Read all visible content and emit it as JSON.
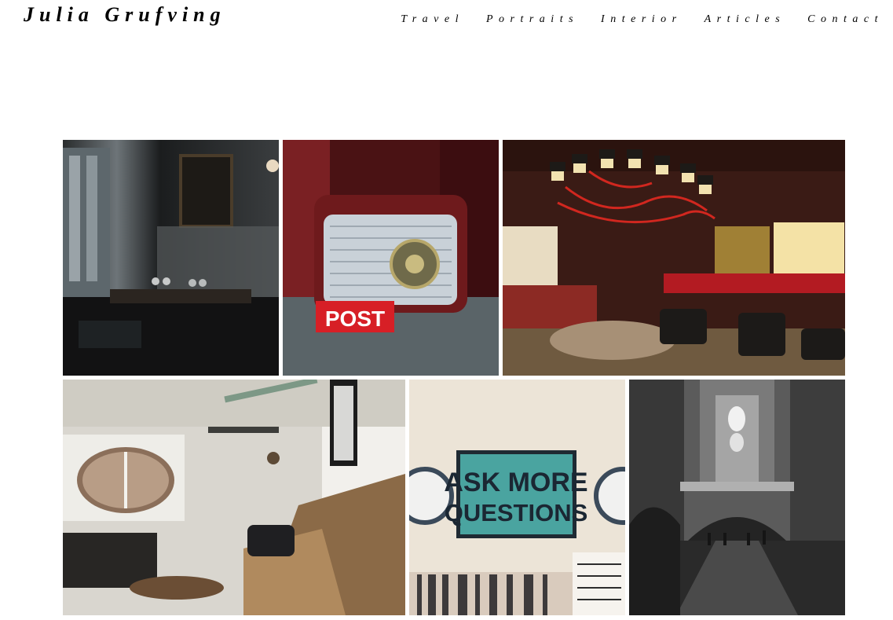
{
  "site": {
    "title": "Julia Grufving"
  },
  "nav": {
    "items": [
      {
        "label": "Travel"
      },
      {
        "label": "Portraits"
      },
      {
        "label": "Interior"
      },
      {
        "label": "Articles"
      },
      {
        "label": "Contact"
      }
    ]
  },
  "gallery": {
    "photos": [
      {
        "subject": "dark restaurant dining room with wine glasses"
      },
      {
        "subject": "vintage radio on magazine",
        "sign_text": "POST"
      },
      {
        "subject": "hotel bar with red chandelier"
      },
      {
        "subject": "bright room with round window and wooden bench"
      },
      {
        "subject": "poster between two wall clocks",
        "sign_line1": "ASK MORE",
        "sign_line2": "QUESTIONS"
      },
      {
        "subject": "black and white grand station hall"
      }
    ]
  },
  "colors": {
    "background": "#ffffff",
    "text": "#000000",
    "chandelier_red": "#c8281e",
    "poster_teal": "#4aa4a0"
  }
}
